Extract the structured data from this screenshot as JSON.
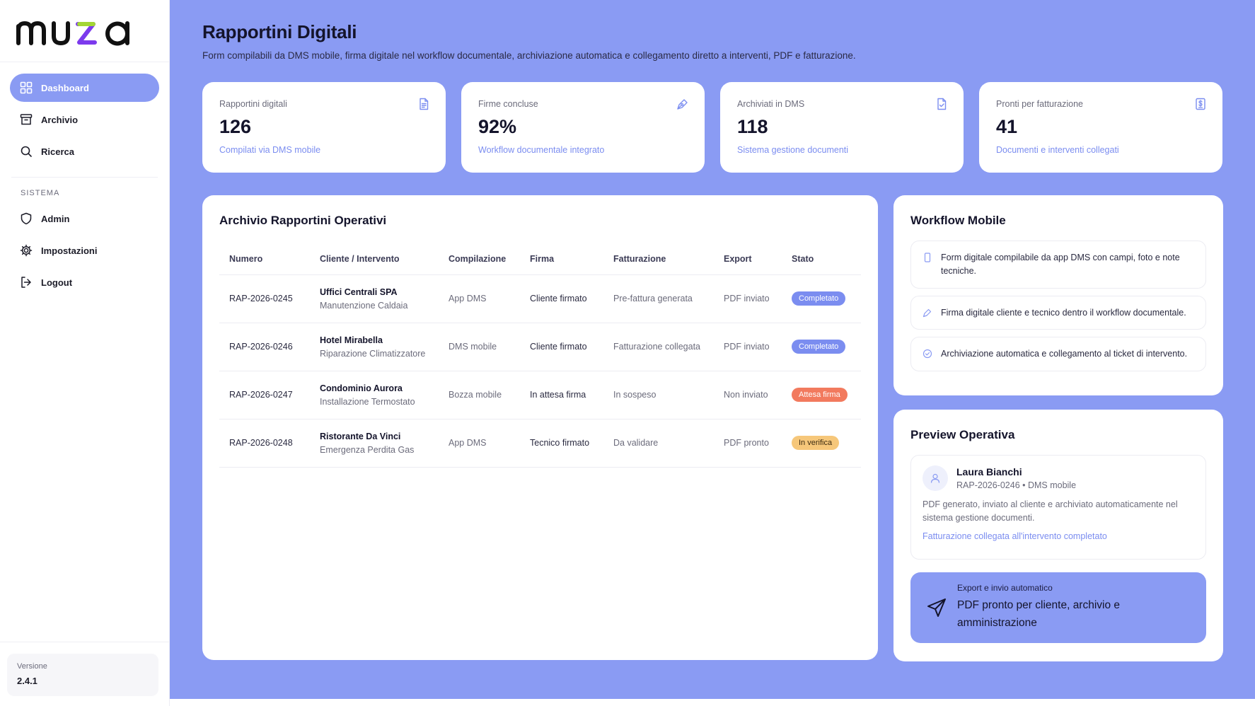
{
  "brand": {
    "name": "muza",
    "accent": "#8a9bf3",
    "logo_colors": [
      "#111111",
      "#7c3aed",
      "#a3d635"
    ]
  },
  "sidebar": {
    "items": [
      {
        "label": "Dashboard",
        "icon": "grid-icon",
        "active": true
      },
      {
        "label": "Archivio",
        "icon": "archive-icon",
        "active": false
      },
      {
        "label": "Ricerca",
        "icon": "search-icon",
        "active": false
      }
    ],
    "section_label": "SISTEMA",
    "system_items": [
      {
        "label": "Admin",
        "icon": "shield-icon"
      },
      {
        "label": "Impostazioni",
        "icon": "gear-icon"
      },
      {
        "label": "Logout",
        "icon": "logout-icon"
      }
    ],
    "version": {
      "label": "Versione",
      "value": "2.4.1"
    }
  },
  "header": {
    "title": "Rapportini Digitali",
    "subtitle": "Form compilabili da DMS mobile, firma digitale nel workflow documentale, archiviazione automatica e collegamento diretto a interventi, PDF e fatturazione."
  },
  "kpis": [
    {
      "label": "Rapportini digitali",
      "value": "126",
      "sub": "Compilati via DMS mobile",
      "icon": "document-icon"
    },
    {
      "label": "Firme concluse",
      "value": "92%",
      "sub": "Workflow documentale integrato",
      "icon": "pen-icon"
    },
    {
      "label": "Archiviati in DMS",
      "value": "118",
      "sub": "Sistema gestione documenti",
      "icon": "file-check-icon"
    },
    {
      "label": "Pronti per fatturazione",
      "value": "41",
      "sub": "Documenti e interventi collegati",
      "icon": "invoice-icon"
    }
  ],
  "table": {
    "title": "Archivio Rapportini Operativi",
    "columns": [
      "Numero",
      "Cliente / Intervento",
      "Compilazione",
      "Firma",
      "Fatturazione",
      "Export",
      "Stato"
    ],
    "rows": [
      {
        "numero": "RAP-2026-0245",
        "cliente": "Uffici Centrali SPA",
        "intervento": "Manutenzione Caldaia",
        "compilazione": "App DMS",
        "firma": "Cliente firmato",
        "fatturazione": "Pre-fattura generata",
        "export": "PDF inviato",
        "stato": "Completato",
        "stato_type": "done"
      },
      {
        "numero": "RAP-2026-0246",
        "cliente": "Hotel Mirabella",
        "intervento": "Riparazione Climatizzatore",
        "compilazione": "DMS mobile",
        "firma": "Cliente firmato",
        "fatturazione": "Fatturazione collegata",
        "export": "PDF inviato",
        "stato": "Completato",
        "stato_type": "done"
      },
      {
        "numero": "RAP-2026-0247",
        "cliente": "Condominio Aurora",
        "intervento": "Installazione Termostato",
        "compilazione": "Bozza mobile",
        "firma": "In attesa firma",
        "fatturazione": "In sospeso",
        "export": "Non inviato",
        "stato": "Attesa firma",
        "stato_type": "wait"
      },
      {
        "numero": "RAP-2026-0248",
        "cliente": "Ristorante Da Vinci",
        "intervento": "Emergenza Perdita Gas",
        "compilazione": "App DMS",
        "firma": "Tecnico firmato",
        "fatturazione": "Da validare",
        "export": "PDF pronto",
        "stato": "In verifica",
        "stato_type": "check"
      }
    ]
  },
  "workflow": {
    "title": "Workflow Mobile",
    "items": [
      {
        "text": "Form digitale compilabile da app DMS con campi, foto e note tecniche.",
        "icon": "phone-icon"
      },
      {
        "text": "Firma digitale cliente e tecnico dentro il workflow documentale.",
        "icon": "pen-icon"
      },
      {
        "text": "Archiviazione automatica e collegamento al ticket di intervento.",
        "icon": "check-circle-icon"
      }
    ]
  },
  "preview": {
    "title": "Preview Operativa",
    "name": "Laura Bianchi",
    "meta": "RAP-2026-0246 • DMS mobile",
    "description": "PDF generato, inviato al cliente e archiviato automaticamente nel sistema gestione documenti.",
    "link": "Fatturazione collegata all'intervento completato",
    "export_label": "Export e invio automatico",
    "export_text": "PDF pronto per cliente, archivio e amministrazione"
  }
}
